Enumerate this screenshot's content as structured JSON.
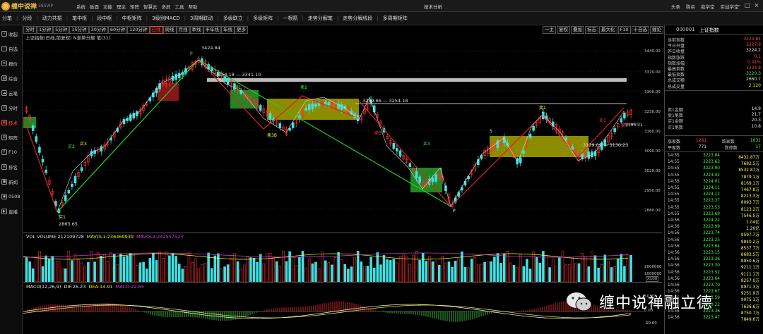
{
  "app": {
    "name": "缠中说禅",
    "version": "365VIP",
    "window_title": "技术分析"
  },
  "top_menu": [
    "系统",
    "板面",
    "功能",
    "理论",
    "矩阵",
    "智慧云",
    "多屏",
    "工具",
    "帮助"
  ],
  "top_right_menu": [
    "头条",
    "购买",
    "我学堂",
    "实战学堂"
  ],
  "toolbar": [
    "分笔",
    "分段",
    "动力共振",
    "笔中枢",
    "段中枢",
    "中枢矩阵",
    "3级别MACD",
    "3周期联动",
    "多级联立",
    "多级矩阵",
    "一根筋",
    "走势分解笔",
    "走势分解线段",
    "多周期矩阵"
  ],
  "left_nav": [
    {
      "label": "收起",
      "icon": "«"
    },
    {
      "label": "自选",
      "icon": "☆"
    },
    {
      "label": "报价",
      "icon": "≡"
    },
    {
      "label": "综合",
      "icon": "▤"
    },
    {
      "label": "云笔",
      "icon": "☁"
    },
    {
      "label": "分时",
      "icon": "◷"
    },
    {
      "label": "技术",
      "icon": "▦"
    },
    {
      "label": "矩阵",
      "icon": "⊞"
    },
    {
      "label": "F10",
      "icon": "F"
    },
    {
      "label": "排名",
      "icon": "≣"
    },
    {
      "label": "新闻",
      "icon": "▣"
    },
    {
      "label": "0508",
      "icon": "◉"
    },
    {
      "label": "直播",
      "icon": "▶"
    }
  ],
  "period_tabs": [
    "分时",
    "1分钟",
    "5分钟",
    "15分钟",
    "30分钟",
    "60分钟",
    "120分钟",
    "日线",
    "周线",
    "月线",
    "季线",
    "半年线",
    "年线",
    "更多"
  ],
  "period_active": "日线",
  "chart_buttons": [
    "一主",
    "复权",
    "叠加",
    "标志",
    "最大化",
    "F10",
    "十自选",
    "缠论"
  ],
  "chart_info": "上证指数(日线,前复权)  N走势分解  笔(31)",
  "price_labels": {
    "high": "3424.84",
    "low": "2863.65",
    "seg1": "3354.18 — 3341.10",
    "seg2": "3259.66 — 3254.18",
    "seg3": "3129.09 — 3130.23",
    "cur": "3195.31 — 3197.36"
  },
  "markers": [
    "买1",
    "买2",
    "买3",
    "卖1",
    "卖2",
    "卖3",
    "卖3B",
    "S",
    "P"
  ],
  "y_ticks": [
    "3440.00",
    "3370.00",
    "3300.00",
    "3230.00",
    "3160.00",
    "3090.00",
    "3020.00",
    "2950.00",
    "2880.00"
  ],
  "volume": {
    "label": "VOL VOLUME:212109728",
    "mavol1": "MAVOL1:236469939",
    "mavol2": "MAVOL2:242557523",
    "ticks": [
      "2000000",
      "1000000"
    ],
    "unit": "X100"
  },
  "macd": {
    "label": "MACD(12,26,9)",
    "dif": "DIF:26.23",
    "dea": "DEA:14.91",
    "macd": "MACD:22.65",
    "ticks": [
      "50.00",
      "0.00",
      "-50.00"
    ]
  },
  "right_panel": {
    "code": "000001",
    "name": "上证指数",
    "stats": [
      {
        "k": "当前指数",
        "v": "3224.84",
        "c": "red"
      },
      {
        "k": "今日开盘",
        "v": "3227.9",
        "c": "red"
      },
      {
        "k": "昨日收盘",
        "v": "3224.2",
        "c": "wht"
      },
      {
        "k": "指数涨跌",
        "v": "0.1",
        "c": "red"
      },
      {
        "k": "指数涨幅",
        "v": "0.01%",
        "c": "red"
      },
      {
        "k": "最高指数",
        "v": "3234.8",
        "c": "red"
      },
      {
        "k": "最低指数",
        "v": "3220.3",
        "c": "grn"
      },
      {
        "k": "总成交额",
        "v": "2660.7",
        "c": "wht"
      },
      {
        "k": "总成交量",
        "v": "2.120",
        "c": "ylw"
      }
    ],
    "orders": [
      {
        "k": "卖1金额",
        "v": "14.9"
      },
      {
        "k": "卖1笔数",
        "v": "21.7"
      },
      {
        "k": "买1金额",
        "v": "20.3"
      },
      {
        "k": "买1笔数",
        "v": "10.8"
      }
    ],
    "updown": {
      "up_label": "涨家数",
      "up": "1281",
      "down_label": "跌家数",
      "down": "1631",
      "flat_label": "平家数",
      "flat": "771",
      "stop_label": "跌停数",
      "stop": "17"
    },
    "ticks": [
      {
        "t": "14:55",
        "p": "3223.84",
        "v": "8432.87万"
      },
      {
        "t": "14:55",
        "p": "3223.63",
        "v": "7682.5万"
      },
      {
        "t": "14:55",
        "p": "3223.90",
        "v": "8532.87万"
      },
      {
        "t": "14:55",
        "p": "3224.02",
        "v": "7879.1万"
      },
      {
        "t": "14:55",
        "p": "3224.01",
        "v": "8169.1万"
      },
      {
        "t": "14:55",
        "p": "3224.11",
        "v": "7467.8万"
      },
      {
        "t": "14:55",
        "p": "3224.12",
        "v": "8213.3万"
      },
      {
        "t": "14:55",
        "p": "3223.37",
        "v": "8093.7万"
      },
      {
        "t": "14:55",
        "p": "3223.53",
        "v": "8123.2万"
      },
      {
        "t": "14:55",
        "p": "3223.69",
        "v": "7546.5万"
      },
      {
        "t": "14:56",
        "p": "3224.22",
        "v": "1.04亿"
      },
      {
        "t": "14:56",
        "p": "3223.99",
        "v": "1.20亿"
      },
      {
        "t": "14:56",
        "p": "3223.74",
        "v": "9597.7万"
      },
      {
        "t": "14:56",
        "p": "3223.25",
        "v": "9840.2万"
      },
      {
        "t": "14:56",
        "p": "3223.64",
        "v": "8537.7万"
      },
      {
        "t": "14:56",
        "p": "3223.15",
        "v": "8683.5万"
      },
      {
        "t": "14:56",
        "p": "3223.36",
        "v": "8950.6万"
      },
      {
        "t": "14:56",
        "p": "3223.30",
        "v": "9211.1万"
      },
      {
        "t": "14:56",
        "p": "3223.52",
        "v": "9111.1万"
      },
      {
        "t": "14:56",
        "p": "3223.64",
        "v": "8257.0万"
      },
      {
        "t": "14:56",
        "p": "3223.70",
        "v": "8971.3万"
      },
      {
        "t": "14:56",
        "p": "3223.67",
        "v": "9251.9万"
      },
      {
        "t": "14:56",
        "p": "3223.59",
        "v": "9075.1万"
      },
      {
        "t": "14:56",
        "p": "3223.22",
        "v": "7636.6万"
      },
      {
        "t": "14:56",
        "p": "3223.36",
        "v": "8750.7万"
      },
      {
        "t": "14:56",
        "p": "3223.47",
        "v": "7849.6万"
      }
    ]
  },
  "watermark": "缠中说禅融立德",
  "colors": {
    "up": "#ff4040",
    "down": "#40e0e0",
    "zone_yellow": "#c8c800",
    "zone_green": "#30c030",
    "trend_green": "#20d020",
    "trend_red": "#e02020"
  }
}
